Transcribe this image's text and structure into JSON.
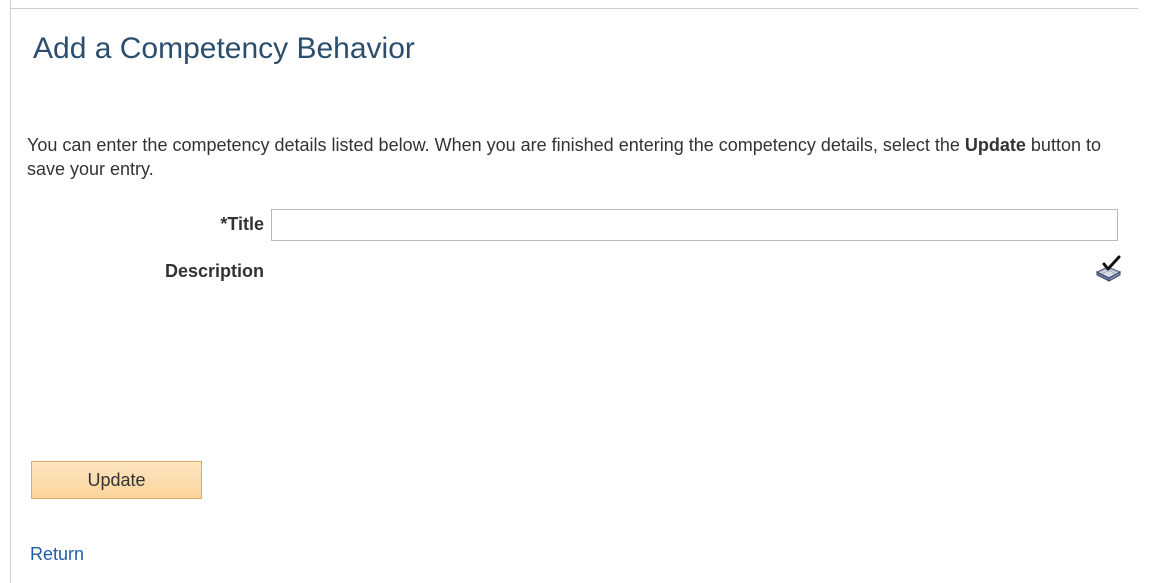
{
  "page": {
    "title": "Add a Competency Behavior"
  },
  "instructions": {
    "text_before": "You can enter the competency details listed below. When you are finished entering the competency details, select the ",
    "bold_word": "Update",
    "text_after": " button to save your entry."
  },
  "form": {
    "title_label": "*Title",
    "title_value": "",
    "description_label": "Description",
    "spellcheck_icon": "spell-check-icon"
  },
  "actions": {
    "update_label": "Update",
    "return_label": "Return"
  }
}
